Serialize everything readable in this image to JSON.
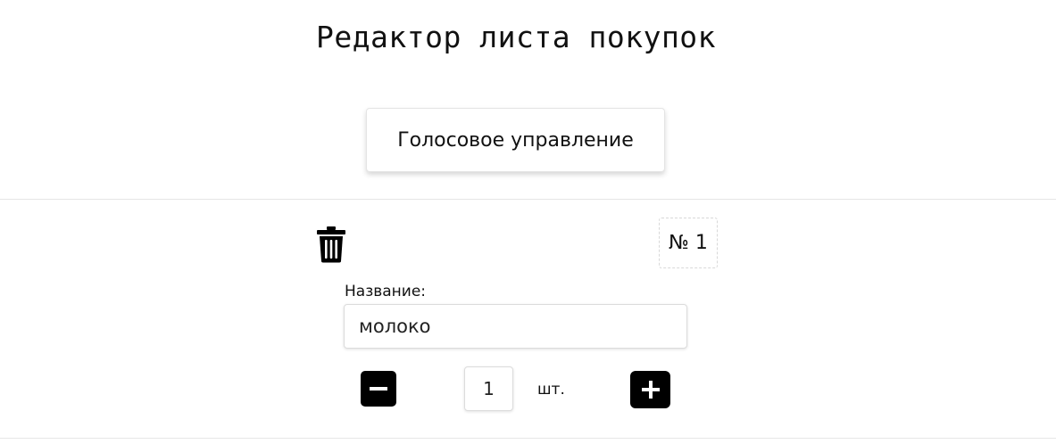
{
  "header": {
    "title": "Редактор листа покупок"
  },
  "voice_control": {
    "label": "Голосовое управление"
  },
  "items": [
    {
      "number_label": "№ 1",
      "name_label": "Название:",
      "name_value": "молоко",
      "quantity": "1",
      "unit": "шт.",
      "delete_icon": "trash-icon",
      "decrement_icon": "minus-icon",
      "increment_icon": "plus-icon"
    }
  ]
}
